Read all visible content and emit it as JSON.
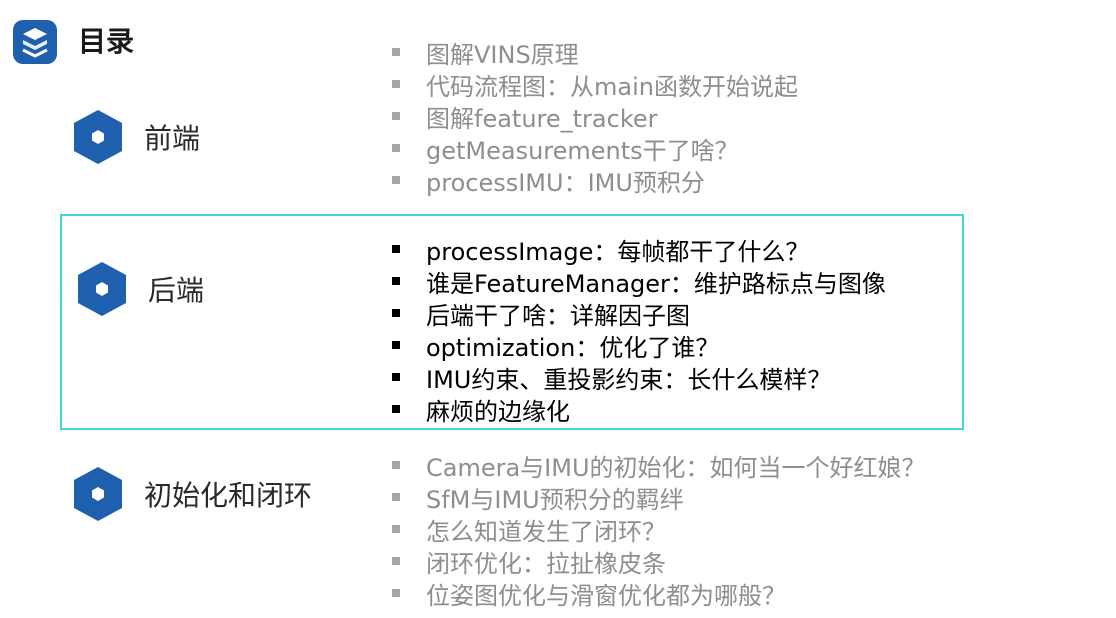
{
  "header": {
    "title": "目录",
    "logo_icon": "stacked-s-logo-icon"
  },
  "colors": {
    "accent": "#1e5fae",
    "highlight_border": "#3fd4de",
    "muted_text": "#8e8e8e"
  },
  "sections": [
    {
      "label": "前端",
      "icon": "hexagon-icon",
      "highlighted": false,
      "items": [
        "图解VINS原理",
        "代码流程图：从main函数开始说起",
        "图解feature_tracker",
        "getMeasurements干了啥？",
        "processIMU：IMU预积分"
      ]
    },
    {
      "label": "后端",
      "icon": "hexagon-icon",
      "highlighted": true,
      "items": [
        "processImage：每帧都干了什么？",
        "谁是FeatureManager：维护路标点与图像",
        "后端干了啥：详解因子图",
        "optimization：优化了谁？",
        "IMU约束、重投影约束：长什么模样？",
        "麻烦的边缘化"
      ]
    },
    {
      "label": "初始化和闭环",
      "icon": "hexagon-icon",
      "highlighted": false,
      "items": [
        "Camera与IMU的初始化：如何当一个好红娘？",
        "SfM与IMU预积分的羁绊",
        "怎么知道发生了闭环？",
        "闭环优化：拉扯橡皮条",
        "位姿图优化与滑窗优化都为哪般？"
      ]
    }
  ]
}
